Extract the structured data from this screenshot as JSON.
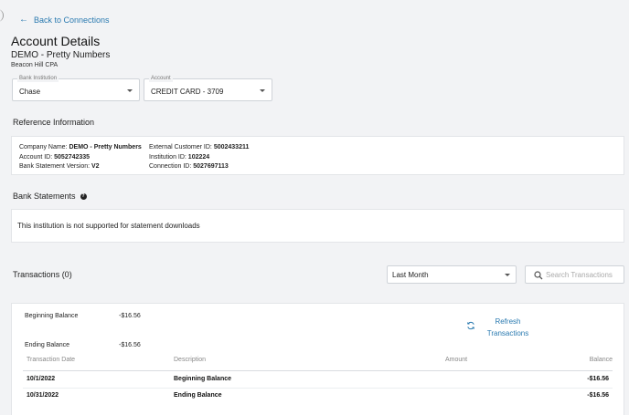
{
  "back_link": {
    "label": "Back to Connections"
  },
  "page_title": "Account Details",
  "client_name": "DEMO - Pretty Numbers",
  "firm_name": "Beacon Hill CPA",
  "bank_field": {
    "label": "Bank Institution",
    "value": "Chase"
  },
  "account_field": {
    "label": "Account",
    "value": "CREDIT CARD - 3709"
  },
  "reference": {
    "title": "Reference Information",
    "col1": [
      {
        "label": "Company Name: ",
        "value": "DEMO - Pretty Numbers"
      },
      {
        "label": "Account ID: ",
        "value": "5052742335"
      },
      {
        "label": "Bank Statement Version: ",
        "value": "V2"
      }
    ],
    "col2": [
      {
        "label": "External Customer ID: ",
        "value": "5002433211"
      },
      {
        "label": "Institution ID: ",
        "value": "102224"
      },
      {
        "label": "Connection ID: ",
        "value": "5027697113"
      }
    ]
  },
  "statements": {
    "title": "Bank Statements",
    "help_glyph": "?",
    "message": "This institution is not supported for statement downloads"
  },
  "transactions": {
    "title": "Transactions (0)",
    "period": "Last Month",
    "search_placeholder": "Search Transactions",
    "beginning_balance_label": "Beginning Balance",
    "beginning_balance_value": "-$16.56",
    "ending_balance_label": "Ending Balance",
    "ending_balance_value": "-$16.56",
    "refresh_label": "Refresh Transactions",
    "columns": {
      "date": "Transaction Date",
      "description": "Description",
      "amount": "Amount",
      "balance": "Balance"
    },
    "rows": [
      {
        "date": "10/1/2022",
        "description": "Beginning Balance",
        "amount": "",
        "balance": "-$16.56"
      },
      {
        "date": "10/31/2022",
        "description": "Ending Balance",
        "amount": "",
        "balance": "-$16.56"
      }
    ]
  },
  "colors": {
    "accent": "#2a7ab0",
    "background": "#f2f3f5"
  },
  "icons": [
    "arrow-left-icon",
    "chevron-down-icon",
    "help-icon",
    "search-icon",
    "refresh-icon"
  ]
}
